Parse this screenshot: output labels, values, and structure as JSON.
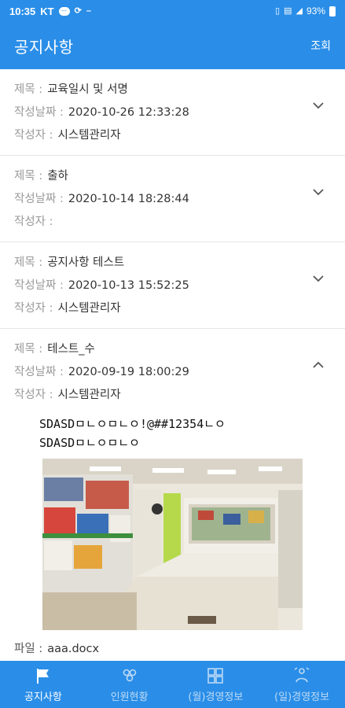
{
  "status_bar": {
    "time": "10:35",
    "carrier": "KT",
    "battery": "93%"
  },
  "appbar": {
    "title": "공지사항",
    "action": "조회"
  },
  "notices": [
    {
      "title_label": "제목 :",
      "title": "교육일시 및 서명",
      "date_label": "작성날짜 :",
      "date": "2020-10-26 12:33:28",
      "author_label": "작성자 :",
      "author": "시스템관리자",
      "expanded": false
    },
    {
      "title_label": "제목 :",
      "title": "출하",
      "date_label": "작성날짜 :",
      "date": "2020-10-14 18:28:44",
      "author_label": "작성자 :",
      "author": "",
      "expanded": false
    },
    {
      "title_label": "제목 :",
      "title": "공지사항 테스트",
      "date_label": "작성날짜 :",
      "date": "2020-10-13 15:52:25",
      "author_label": "작성자 :",
      "author": "시스템관리자",
      "expanded": false
    },
    {
      "title_label": "제목 :",
      "title": "테스트_수",
      "date_label": "작성날짜 :",
      "date": "2020-09-19 18:00:29",
      "author_label": "작성자 :",
      "author": "시스템관리자",
      "expanded": true,
      "body_lines": [
        "SDASDㅁㄴㅇㅁㄴㅇ!@##12354ㄴㅇ",
        "SDASDㅁㄴㅇㅁㄴㅇ"
      ],
      "file_label": "파일 :",
      "file": "aaa.docx"
    }
  ],
  "bottom_nav": [
    {
      "label": "공지사항",
      "icon": "flag-icon",
      "active": true
    },
    {
      "label": "인원현황",
      "icon": "people-icon",
      "active": false
    },
    {
      "label": "(월)경영정보",
      "icon": "dashboard-icon",
      "active": false
    },
    {
      "label": "(일)경영정보",
      "icon": "chart-person-icon",
      "active": false
    }
  ],
  "colors": {
    "primary": "#2a8ee8",
    "divider": "#e6e6e6",
    "label": "#9a9a9a"
  }
}
